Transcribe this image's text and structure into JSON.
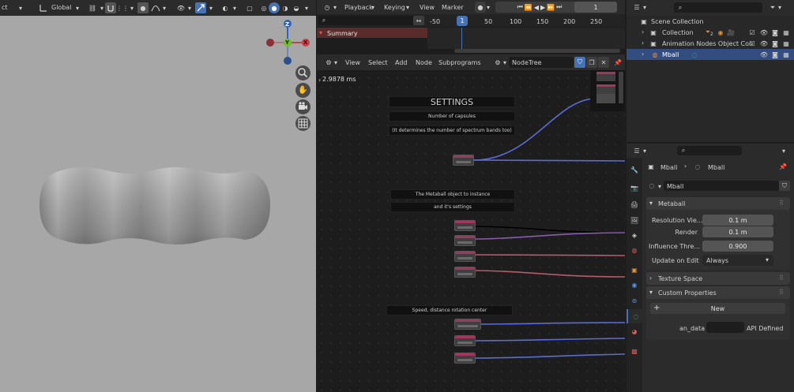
{
  "viewport": {
    "mode_label": "ct",
    "orientation_label": "Global",
    "axis_labels": {
      "z": "Z",
      "y": "Y",
      "x": "X"
    }
  },
  "timeline": {
    "menus": [
      "Playback",
      "Keying",
      "View",
      "Marker"
    ],
    "current_frame": "1",
    "ruler_ticks": [
      "-50",
      "1",
      "50",
      "100",
      "150",
      "200",
      "250"
    ],
    "summary_label": "Summary"
  },
  "node_editor": {
    "menus": [
      "View",
      "Select",
      "Add",
      "Node",
      "Subprograms"
    ],
    "tree_name": "NodeTree",
    "timing": "2.9878 ms",
    "frames": {
      "settings_title": "SETTINGS",
      "capsules_label": "Number of capsules",
      "capsules_note": "(It determines the number of spectrum bands too)",
      "metaball_label": "The Metaball object to instance",
      "metaball_note": "and it's settings",
      "speed_label": "Speed, distance rotation center"
    }
  },
  "outliner": {
    "rows": [
      {
        "label": "Scene Collection"
      },
      {
        "label": "Collection",
        "badge": "2"
      },
      {
        "label": "Animation Nodes Object Con"
      },
      {
        "label": "Mball"
      }
    ]
  },
  "properties": {
    "breadcrumb_object": "Mball",
    "breadcrumb_data": "Mball",
    "datablock_name": "Mball",
    "metaball_panel": "Metaball",
    "resolution_viewport_label": "Resolution Vie...",
    "resolution_viewport_value": "0.1 m",
    "render_label": "Render",
    "render_value": "0.1 m",
    "influence_label": "Influence Thre...",
    "influence_value": "0.900",
    "update_label": "Update on Edit",
    "update_value": "Always",
    "texture_space_panel": "Texture Space",
    "custom_props_panel": "Custom Properties",
    "new_label": "New",
    "prop_name": "an_data",
    "prop_type": "API Defined"
  },
  "colors": {
    "accent_blue": "#4772b3",
    "node_header": "#a7345f",
    "link_blue": "#5c6bd6",
    "link_red": "#b75a6b",
    "summary_bg": "#5a2b2b"
  }
}
